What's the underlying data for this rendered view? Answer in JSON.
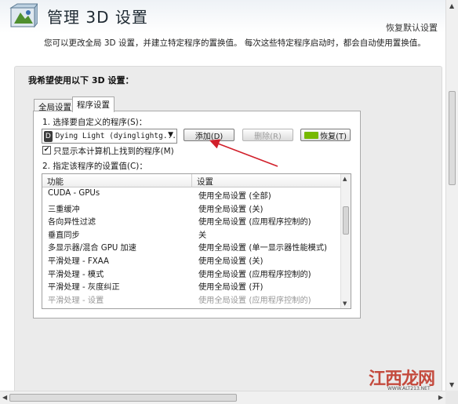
{
  "header": {
    "title": "管理 3D 设置",
    "restore_defaults": "恢复默认设置"
  },
  "description": "您可以更改全局 3D 设置，并建立特定程序的置换值。 每次这些特定程序启动时，都会自动使用置换值。",
  "section": {
    "title": "我希望使用以下 3D 设置：",
    "tabs": [
      {
        "label": "全局设置",
        "active": false
      },
      {
        "label": "程序设置",
        "active": true
      }
    ]
  },
  "program_settings": {
    "step1_label": "1. 选择要自定义的程序(S)：",
    "selected_program": "Dying Light (dyinglightg...",
    "add_button": "添加(D)",
    "remove_button": "删除(R)",
    "restore_button": "恢复(T)",
    "checkbox_label": "只显示本计算机上找到的程序(M)",
    "checkbox_checked": true,
    "step2_label": "2. 指定该程序的设置值(C)："
  },
  "table": {
    "columns": [
      "功能",
      "设置"
    ],
    "rows": [
      {
        "feature": "CUDA - GPUs",
        "setting": "使用全局设置 (全部)"
      },
      {
        "feature": "三重缓冲",
        "setting": "使用全局设置 (关)"
      },
      {
        "feature": "各向异性过滤",
        "setting": "使用全局设置 (应用程序控制的)"
      },
      {
        "feature": "垂直同步",
        "setting": "关"
      },
      {
        "feature": "多显示器/混合 GPU 加速",
        "setting": "使用全局设置 (单一显示器性能模式)"
      },
      {
        "feature": "平滑处理 - FXAA",
        "setting": "使用全局设置 (关)"
      },
      {
        "feature": "平滑处理 - 模式",
        "setting": "使用全局设置 (应用程序控制的)"
      },
      {
        "feature": "平滑处理 - 灰度纠正",
        "setting": "使用全局设置 (开)"
      },
      {
        "feature": "平滑处理 - 设置",
        "setting": "使用全局设置 (应用程序控制的)"
      }
    ]
  },
  "watermark": {
    "text": "江西龙网",
    "url": "WWW.ALT213.NET"
  },
  "colors": {
    "nvidia_green": "#76b900",
    "annotation_red": "#d11f2a"
  },
  "icons": [
    "nvidia-3d-settings-icon",
    "dropdown-arrow-icon",
    "nvidia-logo-icon",
    "checkmark-icon"
  ]
}
